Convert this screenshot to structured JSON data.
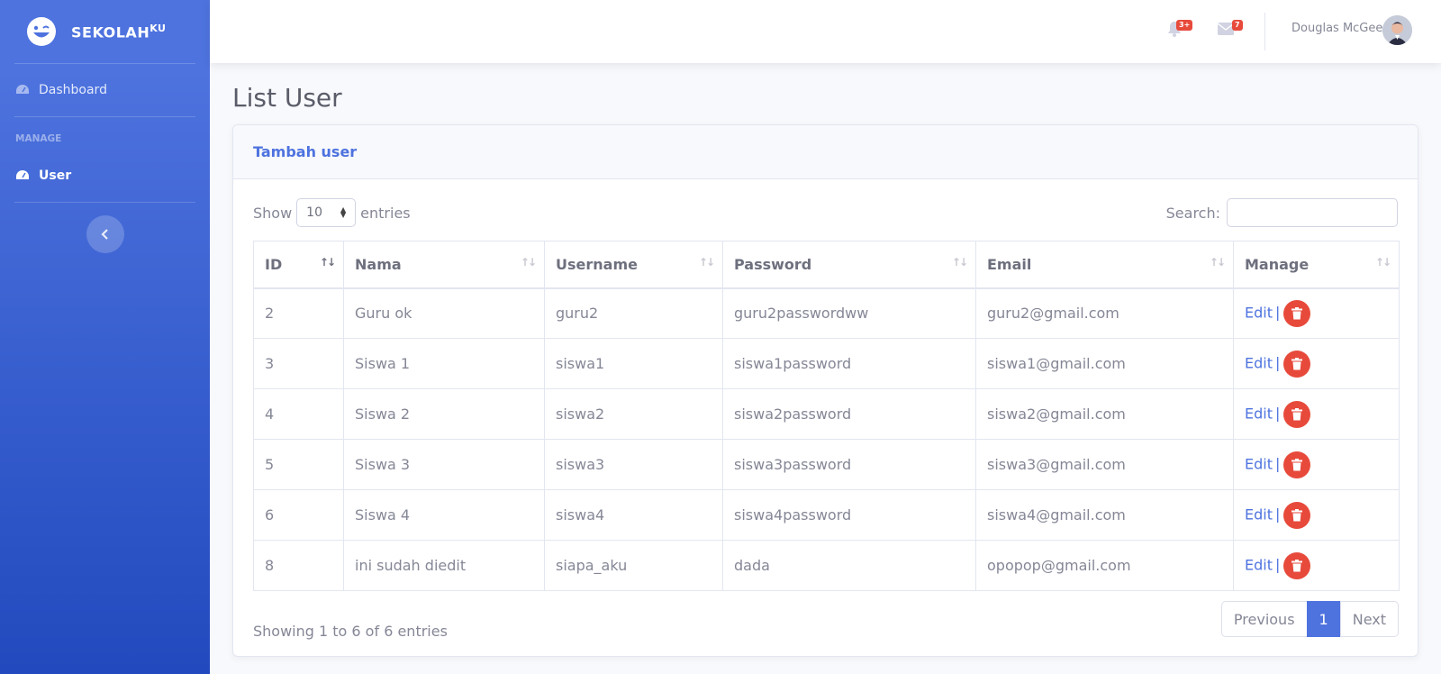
{
  "brand": {
    "name": "SEKOLAH",
    "sup": "KU"
  },
  "sidebar": {
    "items": [
      {
        "label": "Dashboard",
        "icon": "tachometer-icon"
      },
      {
        "label": "User",
        "icon": "tachometer-icon"
      }
    ],
    "heading": "MANAGE"
  },
  "topbar": {
    "alerts_badge": "3+",
    "messages_badge": "7",
    "user_name": "Douglas McGee"
  },
  "page": {
    "title": "List User"
  },
  "card": {
    "header_link": "Tambah user"
  },
  "table_controls": {
    "show_label": "Show",
    "entries_label": "entries",
    "page_size": "10",
    "search_label": "Search:"
  },
  "table": {
    "headers": [
      "ID",
      "Nama",
      "Username",
      "Password",
      "Email",
      "Manage"
    ],
    "rows": [
      [
        "2",
        "Guru ok",
        "guru2",
        "guru2passwordww",
        "guru2@gmail.com"
      ],
      [
        "3",
        "Siswa 1",
        "siswa1",
        "siswa1password",
        "siswa1@gmail.com"
      ],
      [
        "4",
        "Siswa 2",
        "siswa2",
        "siswa2password",
        "siswa2@gmail.com"
      ],
      [
        "5",
        "Siswa 3",
        "siswa3",
        "siswa3password",
        "siswa3@gmail.com"
      ],
      [
        "6",
        "Siswa 4",
        "siswa4",
        "siswa4password",
        "siswa4@gmail.com"
      ],
      [
        "8",
        "ini sudah diedit",
        "siapa_aku",
        "dada",
        "opopop@gmail.com"
      ]
    ],
    "edit_label": "Edit",
    "separator": "|"
  },
  "footer": {
    "info": "Showing 1 to 6 of 6 entries",
    "previous": "Previous",
    "page": "1",
    "next": "Next"
  },
  "colors": {
    "primary": "#4e73df",
    "danger": "#e74a3b"
  }
}
